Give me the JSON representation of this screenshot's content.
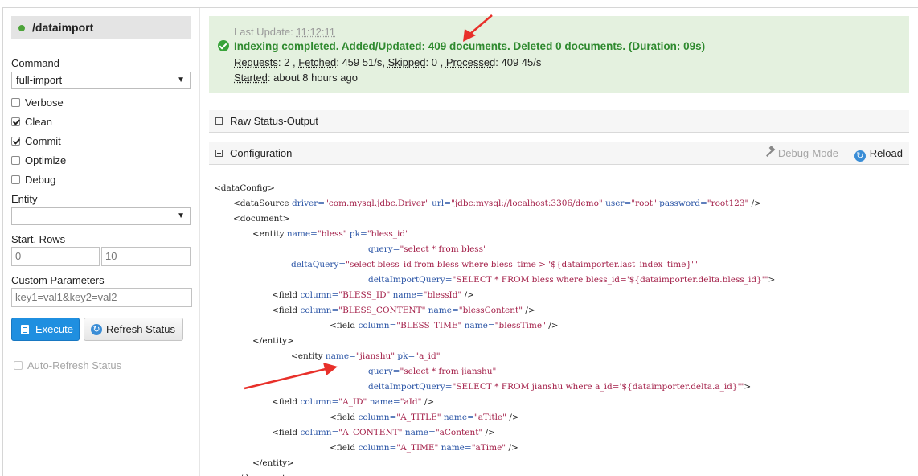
{
  "sidebar": {
    "core_name": "/dataimport",
    "command_label": "Command",
    "command_value": "full-import",
    "options": [
      {
        "label": "Verbose",
        "checked": false
      },
      {
        "label": "Clean",
        "checked": true
      },
      {
        "label": "Commit",
        "checked": true
      },
      {
        "label": "Optimize",
        "checked": false
      },
      {
        "label": "Debug",
        "checked": false
      }
    ],
    "entity_label": "Entity",
    "entity_value": "",
    "start_rows_label": "Start, Rows",
    "start_value": "0",
    "rows_value": "10",
    "custom_params_label": "Custom Parameters",
    "custom_params_value": "key1=val1&key2=val2",
    "execute_label": "Execute",
    "refresh_label": "Refresh Status",
    "auto_refresh_label": "Auto-Refresh Status"
  },
  "status": {
    "last_update_label": "Last Update:",
    "last_update_value": "11:12:11",
    "message": "Indexing completed. Added/Updated: 409 documents. Deleted 0 documents. (Duration: 09s)",
    "requests_label": "Requests",
    "requests_value": ": 2 ,",
    "fetched_label": "Fetched",
    "fetched_value": ": 459 51/s,",
    "skipped_label": "Skipped",
    "skipped_value": ": 0 ,",
    "processed_label": "Processed",
    "processed_value": ": 409 45/s",
    "started_label": "Started",
    "started_value": ": about 8 hours ago"
  },
  "raw_status": {
    "title": "Raw Status-Output"
  },
  "configuration": {
    "title": "Configuration",
    "debug_mode_label": "Debug-Mode",
    "reload_label": "Reload"
  },
  "code_lines": [
    {
      "indent": 0,
      "parts": [
        {
          "t": "<dataConfig>",
          "c": "tag"
        }
      ]
    },
    {
      "indent": 24,
      "parts": [
        {
          "t": "<dataSource ",
          "c": "tag"
        },
        {
          "t": "driver=",
          "c": "an"
        },
        {
          "t": "\"com.mysql.jdbc.Driver\" ",
          "c": "av"
        },
        {
          "t": "url=",
          "c": "an"
        },
        {
          "t": "\"jdbc:mysql://localhost:3306/demo\" ",
          "c": "av"
        },
        {
          "t": "user=",
          "c": "an"
        },
        {
          "t": "\"root\" ",
          "c": "av"
        },
        {
          "t": "password=",
          "c": "an"
        },
        {
          "t": "\"root123\" ",
          "c": "av"
        },
        {
          "t": "/>",
          "c": "tag"
        }
      ]
    },
    {
      "indent": 24,
      "parts": [
        {
          "t": "<document>",
          "c": "tag"
        }
      ]
    },
    {
      "indent": 48,
      "parts": [
        {
          "t": "<entity ",
          "c": "tag"
        },
        {
          "t": "name=",
          "c": "an"
        },
        {
          "t": "\"bless\" ",
          "c": "av"
        },
        {
          "t": "pk=",
          "c": "an"
        },
        {
          "t": "\"bless_id\"",
          "c": "av"
        }
      ]
    },
    {
      "indent": 192,
      "parts": [
        {
          "t": "query=",
          "c": "an"
        },
        {
          "t": "\"select * from bless\"",
          "c": "av"
        }
      ]
    },
    {
      "indent": 96,
      "parts": [
        {
          "t": "deltaQuery=",
          "c": "an"
        },
        {
          "t": "\"select bless_id from bless where bless_time > '${dataimporter.last_index_time}'\"",
          "c": "av"
        }
      ]
    },
    {
      "indent": 192,
      "parts": [
        {
          "t": "deltaImportQuery=",
          "c": "an"
        },
        {
          "t": "\"SELECT * FROM bless where bless_id='${dataimporter.delta.bless_id}'\"",
          "c": "av"
        },
        {
          "t": ">",
          "c": "tag"
        }
      ]
    },
    {
      "indent": 72,
      "parts": [
        {
          "t": "<field ",
          "c": "tag"
        },
        {
          "t": "column=",
          "c": "an"
        },
        {
          "t": "\"BLESS_ID\" ",
          "c": "av"
        },
        {
          "t": "name=",
          "c": "an"
        },
        {
          "t": "\"blessId\" ",
          "c": "av"
        },
        {
          "t": "/>",
          "c": "tag"
        }
      ]
    },
    {
      "indent": 72,
      "parts": [
        {
          "t": "<field ",
          "c": "tag"
        },
        {
          "t": "column=",
          "c": "an"
        },
        {
          "t": "\"BLESS_CONTENT\" ",
          "c": "av"
        },
        {
          "t": "name=",
          "c": "an"
        },
        {
          "t": "\"blessContent\" ",
          "c": "av"
        },
        {
          "t": "/>",
          "c": "tag"
        }
      ]
    },
    {
      "indent": 144,
      "parts": [
        {
          "t": "<field ",
          "c": "tag"
        },
        {
          "t": "column=",
          "c": "an"
        },
        {
          "t": "\"BLESS_TIME\" ",
          "c": "av"
        },
        {
          "t": "name=",
          "c": "an"
        },
        {
          "t": "\"blessTime\" ",
          "c": "av"
        },
        {
          "t": "/>",
          "c": "tag"
        }
      ]
    },
    {
      "indent": 48,
      "parts": [
        {
          "t": "</entity>",
          "c": "tag"
        }
      ]
    },
    {
      "indent": 96,
      "parts": [
        {
          "t": "<entity ",
          "c": "tag"
        },
        {
          "t": "name=",
          "c": "an"
        },
        {
          "t": "\"jianshu\" ",
          "c": "av"
        },
        {
          "t": "pk=",
          "c": "an"
        },
        {
          "t": "\"a_id\"",
          "c": "av"
        }
      ]
    },
    {
      "indent": 192,
      "parts": [
        {
          "t": "query=",
          "c": "an"
        },
        {
          "t": "\"select * from jianshu\"",
          "c": "av"
        }
      ]
    },
    {
      "indent": 192,
      "parts": [
        {
          "t": "deltaImportQuery=",
          "c": "an"
        },
        {
          "t": "\"SELECT * FROM jianshu where a_id='${dataimporter.delta.a_id}'\"",
          "c": "av"
        },
        {
          "t": ">",
          "c": "tag"
        }
      ]
    },
    {
      "indent": 72,
      "parts": [
        {
          "t": "<field ",
          "c": "tag"
        },
        {
          "t": "column=",
          "c": "an"
        },
        {
          "t": "\"A_ID\" ",
          "c": "av"
        },
        {
          "t": "name=",
          "c": "an"
        },
        {
          "t": "\"aId\" ",
          "c": "av"
        },
        {
          "t": "/>",
          "c": "tag"
        }
      ]
    },
    {
      "indent": 144,
      "parts": [
        {
          "t": "<field ",
          "c": "tag"
        },
        {
          "t": "column=",
          "c": "an"
        },
        {
          "t": "\"A_TITLE\" ",
          "c": "av"
        },
        {
          "t": "name=",
          "c": "an"
        },
        {
          "t": "\"aTitle\" ",
          "c": "av"
        },
        {
          "t": "/>",
          "c": "tag"
        }
      ]
    },
    {
      "indent": 72,
      "parts": [
        {
          "t": "<field ",
          "c": "tag"
        },
        {
          "t": "column=",
          "c": "an"
        },
        {
          "t": "\"A_CONTENT\" ",
          "c": "av"
        },
        {
          "t": "name=",
          "c": "an"
        },
        {
          "t": "\"aContent\" ",
          "c": "av"
        },
        {
          "t": "/>",
          "c": "tag"
        }
      ]
    },
    {
      "indent": 144,
      "parts": [
        {
          "t": "<field ",
          "c": "tag"
        },
        {
          "t": "column=",
          "c": "an"
        },
        {
          "t": "\"A_TIME\" ",
          "c": "av"
        },
        {
          "t": "name=",
          "c": "an"
        },
        {
          "t": "\"aTime\" ",
          "c": "av"
        },
        {
          "t": "/>",
          "c": "tag"
        }
      ]
    },
    {
      "indent": 48,
      "parts": [
        {
          "t": "</entity>",
          "c": "tag"
        }
      ]
    },
    {
      "indent": 24,
      "parts": [
        {
          "t": "</document>",
          "c": "tag"
        }
      ]
    }
  ],
  "colors": {
    "status_bg": "#e4f1df",
    "success_text": "#2f8a2f",
    "primary_button": "#1f8fe0",
    "annotation_arrow": "#e8302a",
    "attr_name": "#2b55a6",
    "attr_value": "#a4214a"
  }
}
